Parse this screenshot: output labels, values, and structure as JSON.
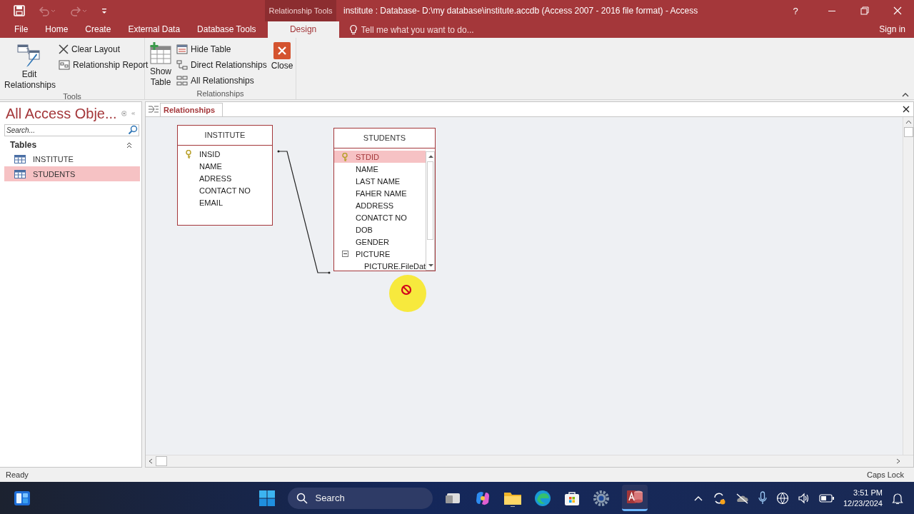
{
  "window": {
    "context_group": "Relationship Tools",
    "title": "institute : Database- D:\\my database\\institute.accdb (Access 2007 - 2016 file format) - Access",
    "help": "?",
    "sign_in": "Sign in"
  },
  "ribbon_tabs": [
    {
      "label": "File",
      "selected": false
    },
    {
      "label": "Home",
      "selected": false
    },
    {
      "label": "Create",
      "selected": false
    },
    {
      "label": "External Data",
      "selected": false
    },
    {
      "label": "Database Tools",
      "selected": false
    },
    {
      "label": "Design",
      "selected": true
    }
  ],
  "tell_me": {
    "placeholder": "Tell me what you want to do..."
  },
  "ribbon_groups": [
    {
      "label": "Tools",
      "commands": [
        {
          "label": "Edit Relationships",
          "kind": "large"
        },
        {
          "label": "Clear Layout",
          "kind": "small"
        },
        {
          "label": "Relationship Report",
          "kind": "small"
        }
      ]
    },
    {
      "label": "Relationships",
      "commands": [
        {
          "label": "Show Table",
          "kind": "large"
        },
        {
          "label": "Hide Table",
          "kind": "small"
        },
        {
          "label": "Direct Relationships",
          "kind": "small"
        },
        {
          "label": "All Relationships",
          "kind": "small"
        },
        {
          "label": "Close",
          "kind": "large"
        }
      ]
    }
  ],
  "navigation": {
    "title": "All Access Obje...",
    "search": {
      "placeholder": "Search..."
    },
    "groups": [
      {
        "label": "Tables",
        "expanded": true,
        "items": [
          {
            "label": "INSTITUTE",
            "selected": false
          },
          {
            "label": "STUDENTS",
            "selected": true
          }
        ]
      }
    ]
  },
  "document_tabs": [
    {
      "label": "Relationships",
      "selected": true
    }
  ],
  "tables": [
    {
      "title": "INSTITUTE",
      "scrollable": false,
      "fields": [
        {
          "name": "INSID",
          "primary_key": true,
          "selected": false
        },
        {
          "name": "NAME",
          "primary_key": false,
          "selected": false
        },
        {
          "name": "ADRESS",
          "primary_key": false,
          "selected": false
        },
        {
          "name": "CONTACT NO",
          "primary_key": false,
          "selected": false
        },
        {
          "name": "EMAIL",
          "primary_key": false,
          "selected": false
        }
      ]
    },
    {
      "title": "STUDENTS",
      "scrollable": true,
      "fields": [
        {
          "name": "STDID",
          "primary_key": true,
          "selected": true
        },
        {
          "name": "NAME",
          "primary_key": false,
          "selected": false
        },
        {
          "name": "LAST NAME",
          "primary_key": false,
          "selected": false
        },
        {
          "name": "FAHER NAME",
          "primary_key": false,
          "selected": false
        },
        {
          "name": "ADDRESS",
          "primary_key": false,
          "selected": false
        },
        {
          "name": "CONATCT NO",
          "primary_key": false,
          "selected": false
        },
        {
          "name": "DOB",
          "primary_key": false,
          "selected": false
        },
        {
          "name": "GENDER",
          "primary_key": false,
          "selected": false
        },
        {
          "name": "PICTURE",
          "primary_key": false,
          "selected": false,
          "expanded": true,
          "children": [
            {
              "name": "PICTURE.FileDat",
              "primary_key": false,
              "selected": false
            }
          ]
        }
      ]
    }
  ],
  "status_bar": {
    "left": "Ready",
    "right": "Caps Lock"
  },
  "taskbar": {
    "search": {
      "placeholder": "Search"
    },
    "time": "3:51 PM",
    "date": "12/23/2024"
  }
}
